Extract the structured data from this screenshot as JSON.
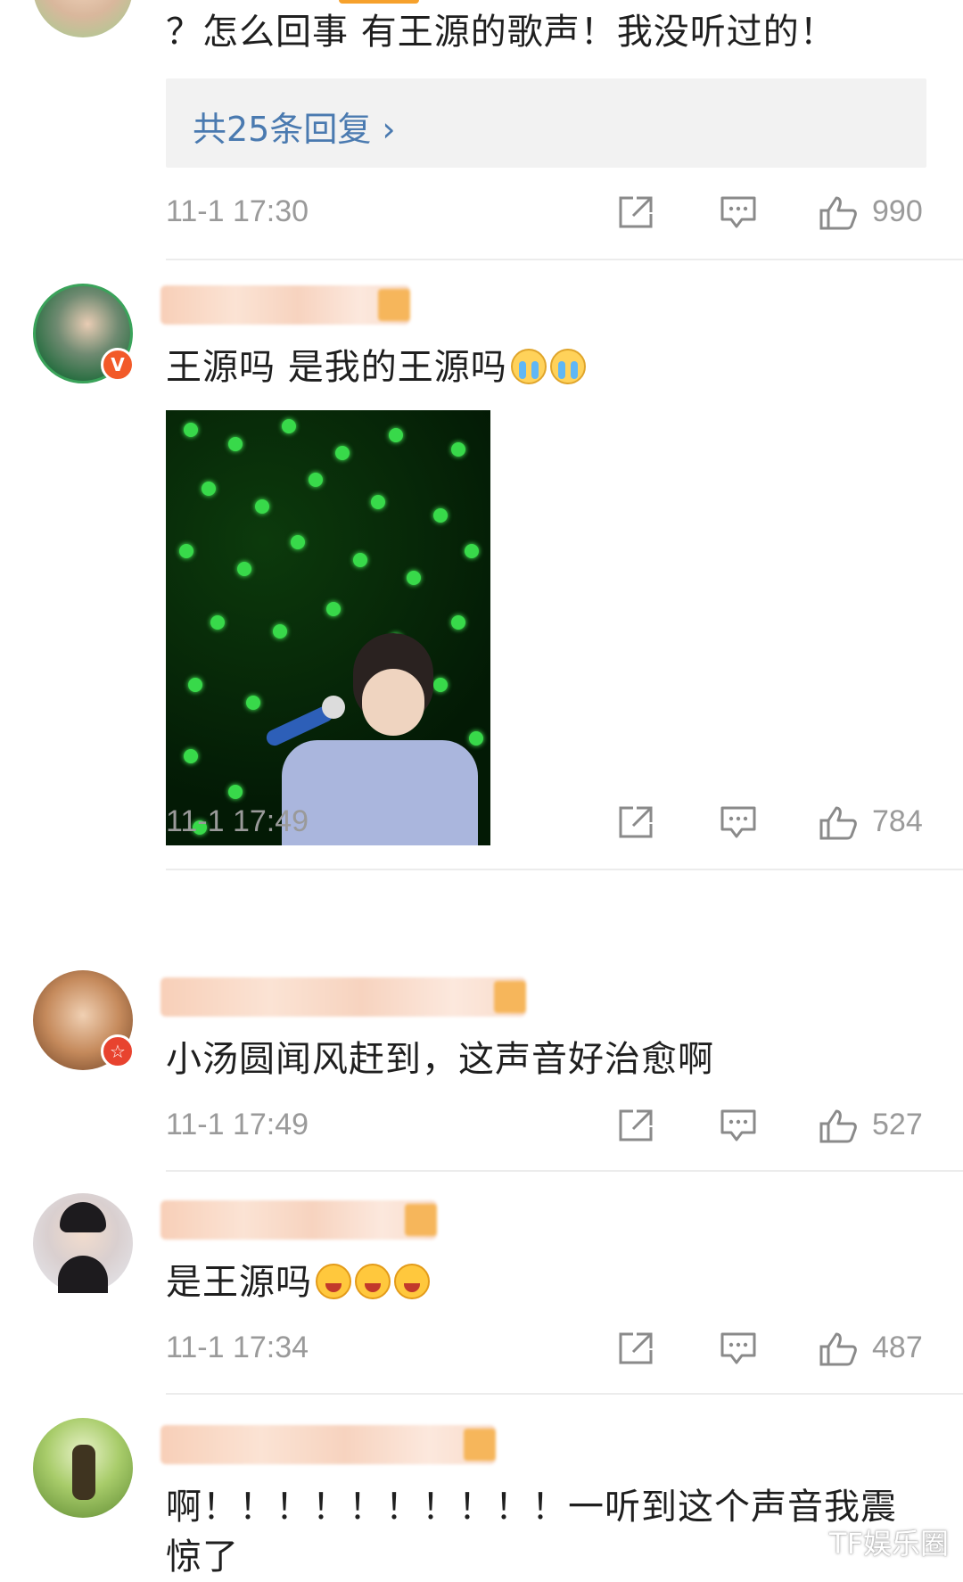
{
  "comments": [
    {
      "text": "？怎么回事 有王源的歌声！我没听过的！",
      "replies_label": "共25条回复 ›",
      "time": "11-1 17:30",
      "likes": "990"
    },
    {
      "text": "王源吗 是我的王源吗",
      "emojis": [
        "cry",
        "cry"
      ],
      "badge": "V",
      "time": "11-1 17:49",
      "likes": "784"
    },
    {
      "text": "小汤圆闻风赶到，这声音好治愈啊",
      "badge": "☆",
      "time": "11-1 17:49",
      "likes": "527"
    },
    {
      "text": "是王源吗",
      "emojis": [
        "grin",
        "grin",
        "grin"
      ],
      "time": "11-1 17:34",
      "likes": "487"
    },
    {
      "text": "啊！！！！！！！！！！一听到这个声音我震惊了",
      "time": "",
      "likes": ""
    }
  ],
  "icons": {
    "share": "share-icon",
    "reply": "reply-icon",
    "like": "thumbs-up-icon"
  },
  "colors": {
    "link": "#4a7ab0",
    "meta_gray": "#9a9a9a",
    "verified_badge": "#f25a29"
  },
  "watermark": "TF娱乐圈"
}
